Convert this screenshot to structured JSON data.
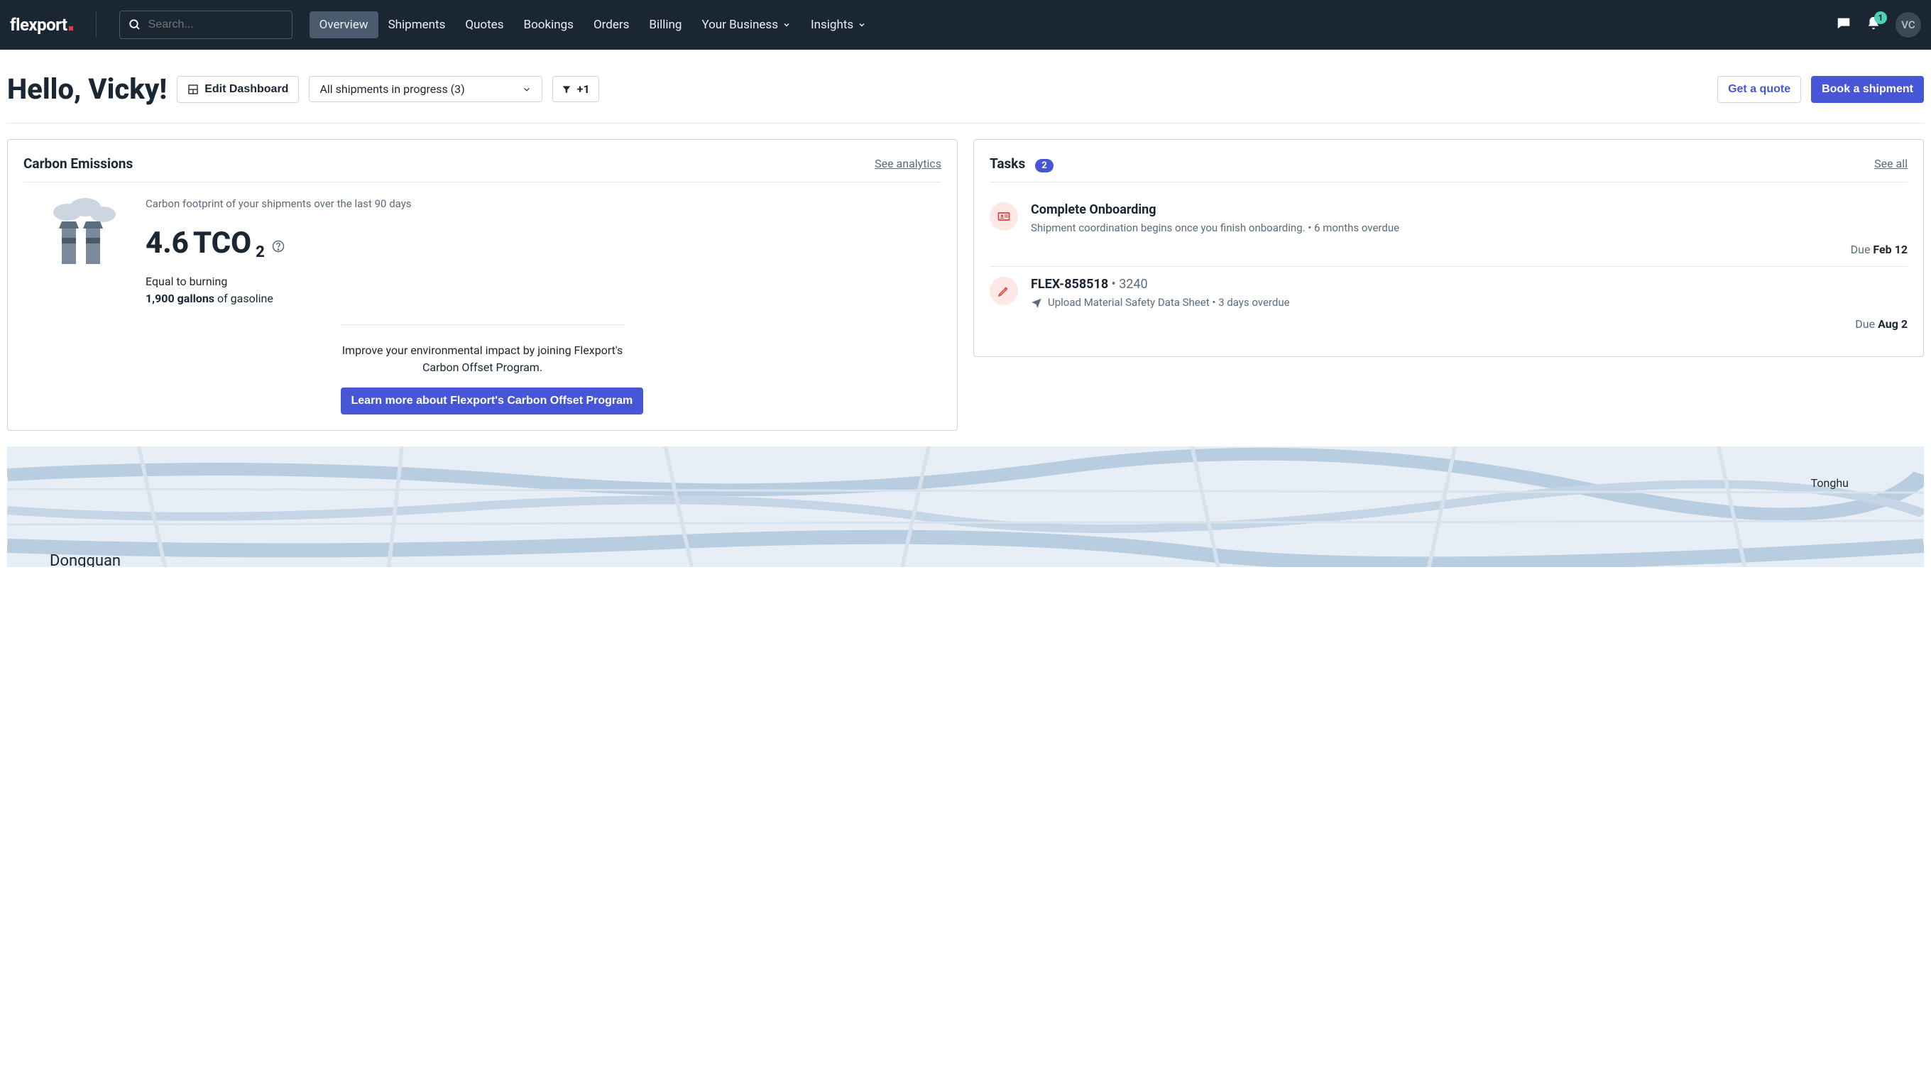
{
  "brand": "flexport",
  "search": {
    "placeholder": "Search..."
  },
  "nav": {
    "overview": "Overview",
    "shipments": "Shipments",
    "quotes": "Quotes",
    "bookings": "Bookings",
    "orders": "Orders",
    "billing": "Billing",
    "your_business": "Your Business",
    "insights": "Insights"
  },
  "notifications_count": "1",
  "avatar_initials": "VC",
  "greeting": "Hello, Vicky!",
  "toolbar": {
    "edit_dashboard": "Edit Dashboard",
    "shipments_filter": "All shipments in progress (3)",
    "plus_filter": "+1",
    "get_quote": "Get a quote",
    "book_shipment": "Book a shipment"
  },
  "carbon": {
    "title": "Carbon Emissions",
    "see_analytics": "See analytics",
    "desc": "Carbon footprint of your shipments over the last 90 days",
    "value": "4.6",
    "unit": "TCO",
    "sub": "2",
    "equiv_pre": "Equal to burning",
    "equiv_bold": "1,900 gallons",
    "equiv_post": " of gasoline",
    "footer_msg": "Improve your environmental impact by joining Flexport's Carbon Offset Program.",
    "learn_more": "Learn more about Flexport's Carbon Offset Program"
  },
  "tasks": {
    "title": "Tasks",
    "count": "2",
    "see_all": "See all",
    "items": [
      {
        "title": "Complete Onboarding",
        "sub": "Shipment coordination begins once you finish onboarding. • 6 months overdue",
        "due_label": "Due ",
        "due_date": "Feb 12"
      },
      {
        "title_main": "FLEX-858518",
        "title_sep": " • ",
        "title_extra": "3240",
        "sub": "Upload Material Safety Data Sheet • 3 days overdue",
        "due_label": "Due ",
        "due_date": "Aug 2"
      }
    ]
  },
  "map": {
    "label_tonghu": "Tonghu",
    "label_dongguan": "Dongguan"
  }
}
